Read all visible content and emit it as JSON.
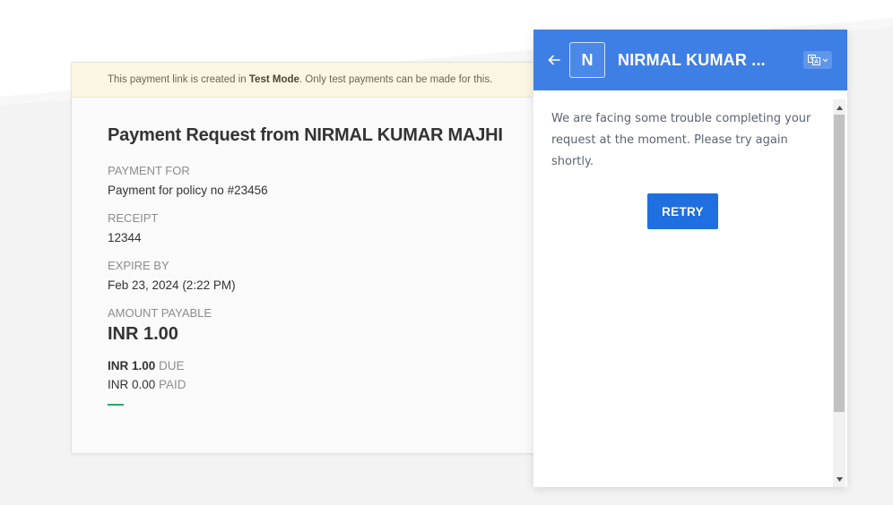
{
  "test_banner": {
    "prefix": "This payment link is created in ",
    "mode": "Test Mode",
    "suffix": ". Only test payments can be made for this."
  },
  "payment": {
    "title": "Payment Request from NIRMAL KUMAR MAJHI",
    "payment_for_label": "PAYMENT FOR",
    "payment_for_value": "Payment for policy no #23456",
    "receipt_label": "RECEIPT",
    "receipt_value": "12344",
    "expire_label": "EXPIRE BY",
    "expire_value": "Feb 23, 2024 (2:22 PM)",
    "amount_label": "AMOUNT PAYABLE",
    "amount_value": "INR 1.00",
    "due_amount": "INR 1.00",
    "due_label": "DUE",
    "paid_amount": "INR 0.00",
    "paid_label": "PAID",
    "paid_fraction": 0
  },
  "checkout": {
    "avatar_letter": "N",
    "merchant_name": "NIRMAL KUMAR ...",
    "error_message": "We are facing some trouble completing your request at the moment. Please try again shortly.",
    "retry_label": "RETRY",
    "back_icon": "arrow-left-icon",
    "language_icon": "translate-icon",
    "header_color": "#3e7fe6",
    "button_color": "#1f6fe0"
  }
}
